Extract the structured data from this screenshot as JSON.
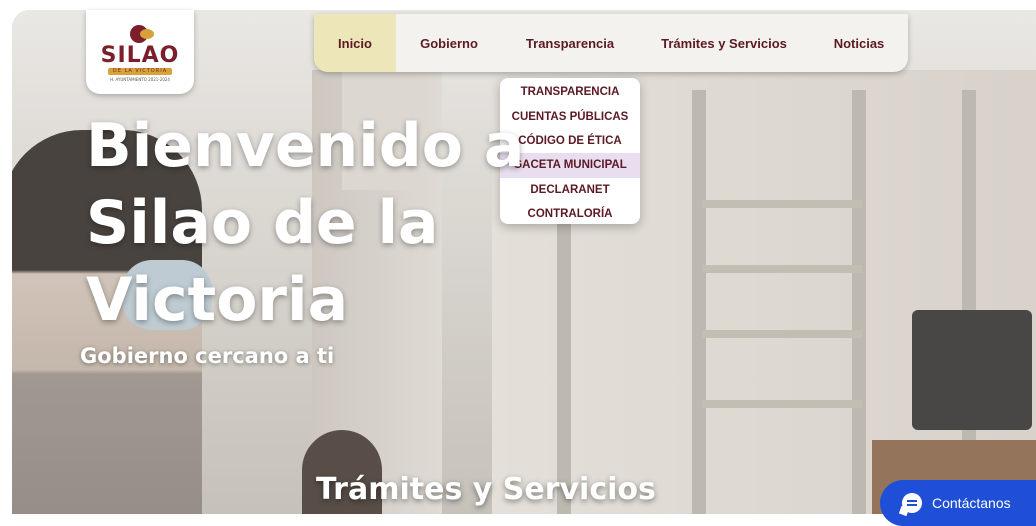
{
  "logo": {
    "name": "SILAO",
    "tagline": "DE LA VICTORIA",
    "subline": "H. AYUNTAMIENTO 2021-2024"
  },
  "nav": {
    "items": [
      {
        "label": "Inicio",
        "active": true
      },
      {
        "label": "Gobierno",
        "active": false
      },
      {
        "label": "Transparencia",
        "active": false
      },
      {
        "label": "Trámites y Servicios",
        "active": false
      },
      {
        "label": "Noticias",
        "active": false
      }
    ]
  },
  "dropdown": {
    "items": [
      {
        "label": "TRANSPARENCIA"
      },
      {
        "label": "CUENTAS PÚBLICAS"
      },
      {
        "label": "CÓDIGO DE ÉTICA"
      },
      {
        "label": "GACETA MUNICIPAL",
        "highlighted": true
      },
      {
        "label": "DECLARANET"
      },
      {
        "label": "CONTRALORÍA"
      }
    ]
  },
  "hero": {
    "title_line1": "Bienvenido a",
    "title_line2": "Silao de la",
    "title_line3": "Victoria",
    "subtitle": "Gobierno cercano a ti"
  },
  "section": {
    "title": "Trámites y Servicios"
  },
  "contact": {
    "label": "Contáctanos",
    "icon": "chat-icon"
  },
  "colors": {
    "brand": "#7a1f2b",
    "accent": "#d8a13a",
    "nav_active_bg": "#ede6b8",
    "contact_bg": "#1f4fd6"
  }
}
